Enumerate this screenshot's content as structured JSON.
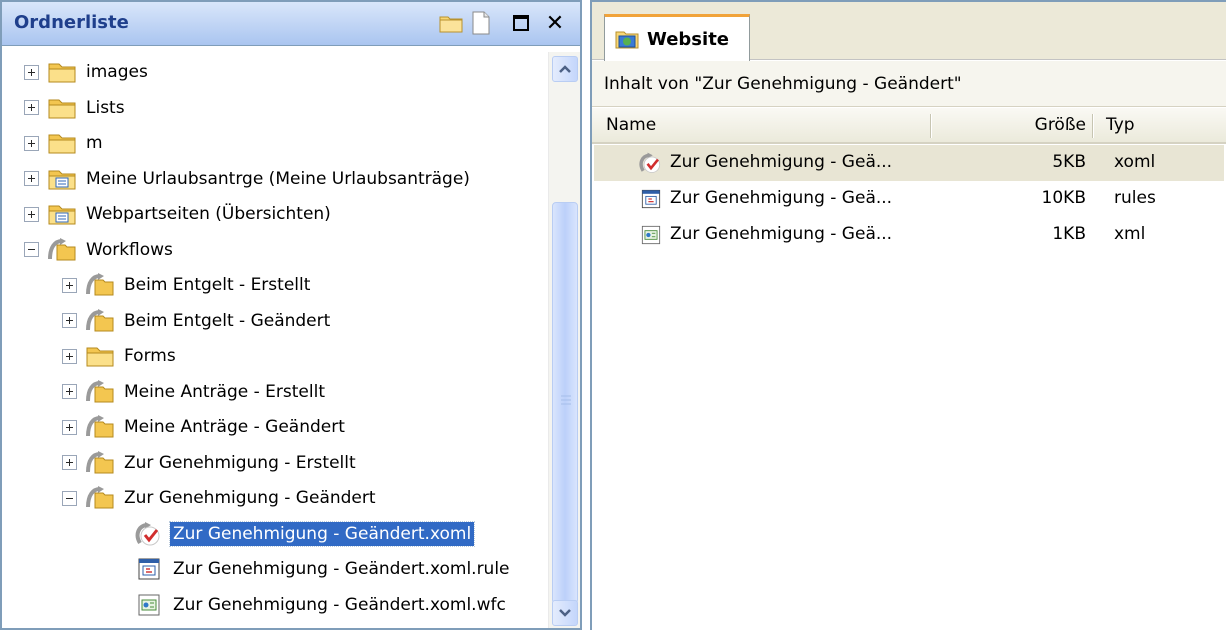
{
  "left_pane": {
    "title": "Ordnerliste",
    "close_glyph": "✕",
    "tree": [
      {
        "label": "images",
        "toggle": "plus",
        "icon": "folder-icon",
        "level": 0
      },
      {
        "label": "Lists",
        "toggle": "plus",
        "icon": "folder-icon",
        "level": 0
      },
      {
        "label": "m",
        "toggle": "plus",
        "icon": "folder-icon",
        "level": 0
      },
      {
        "label": "Meine Urlaubsantrge (Meine Urlaubsanträge)",
        "toggle": "plus",
        "icon": "list-folder-icon",
        "level": 0
      },
      {
        "label": "Webpartseiten (Übersichten)",
        "toggle": "plus",
        "icon": "list-folder-icon",
        "level": 0
      },
      {
        "label": "Workflows",
        "toggle": "minus",
        "icon": "workflow-folder-icon",
        "level": 0
      },
      {
        "label": "Beim Entgelt - Erstellt",
        "toggle": "plus",
        "icon": "workflow-folder-icon",
        "level": 1
      },
      {
        "label": "Beim Entgelt - Geändert",
        "toggle": "plus",
        "icon": "workflow-folder-icon",
        "level": 1
      },
      {
        "label": "Forms",
        "toggle": "plus",
        "icon": "folder-icon",
        "level": 1
      },
      {
        "label": "Meine Anträge - Erstellt",
        "toggle": "plus",
        "icon": "workflow-folder-icon",
        "level": 1
      },
      {
        "label": "Meine Anträge - Geändert",
        "toggle": "plus",
        "icon": "workflow-folder-icon",
        "level": 1
      },
      {
        "label": "Zur Genehmigung - Erstellt",
        "toggle": "plus",
        "icon": "workflow-folder-icon",
        "level": 1
      },
      {
        "label": "Zur Genehmigung - Geändert",
        "toggle": "minus",
        "icon": "workflow-folder-icon",
        "level": 1
      },
      {
        "label": "Zur Genehmigung - Geändert.xoml",
        "toggle": "none",
        "icon": "workflow-check-icon",
        "level": 2,
        "selected": true
      },
      {
        "label": "Zur Genehmigung - Geändert.xoml.rule",
        "toggle": "none",
        "icon": "rules-file-icon",
        "level": 2
      },
      {
        "label": "Zur Genehmigung - Geändert.xoml.wfc",
        "toggle": "none",
        "icon": "xml-file-icon",
        "level": 2
      }
    ]
  },
  "right_pane": {
    "tab_label": "Website",
    "content_title": "Inhalt von \"Zur Genehmigung - Geändert\"",
    "columns": {
      "name": "Name",
      "size": "Größe",
      "type": "Typ"
    },
    "files": [
      {
        "name": "Zur Genehmigung - Geä...",
        "size": "5KB",
        "type": "xoml",
        "icon": "workflow-check-icon",
        "highlighted": true
      },
      {
        "name": "Zur Genehmigung - Geä...",
        "size": "10KB",
        "type": "rules",
        "icon": "rules-file-icon",
        "highlighted": false
      },
      {
        "name": "Zur Genehmigung - Geä...",
        "size": "1KB",
        "type": "xml",
        "icon": "xml-file-icon",
        "highlighted": false
      }
    ]
  },
  "colors": {
    "selection": "#316ac5",
    "header_title": "#1f3f8c",
    "tab_accent": "#f1a33a"
  }
}
